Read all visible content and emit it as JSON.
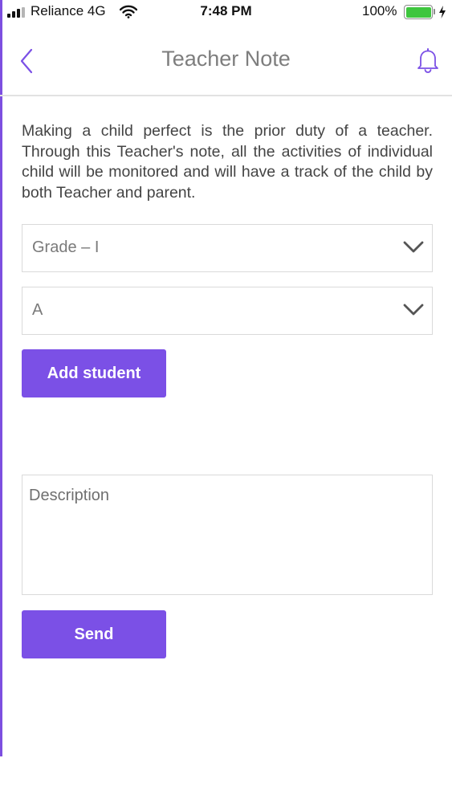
{
  "status_bar": {
    "carrier": "Reliance 4G",
    "time": "7:48 PM",
    "battery_percent": "100%",
    "battery_level": 1.0,
    "signal_bars_active": 3,
    "icons": [
      "signal-icon",
      "wifi-icon",
      "battery-icon",
      "charging-icon"
    ]
  },
  "header": {
    "title": "Teacher Note",
    "back_icon": "chevron-left-icon",
    "notification_icon": "bell-icon"
  },
  "intro_text": "Making a child perfect is the prior duty of a teacher. Through this Teacher's note, all the activities of individual child will be monitored and will have a track of the child by both Teacher and parent.",
  "form": {
    "grade_select": {
      "value": "Grade – I",
      "icon": "chevron-down-icon"
    },
    "section_select": {
      "value": "A",
      "icon": "chevron-down-icon"
    },
    "add_student_label": "Add student",
    "description_placeholder": "Description",
    "description_value": "",
    "send_label": "Send"
  },
  "colors": {
    "accent": "#7b50e6",
    "title": "#7e7e7e",
    "body_text": "#444444",
    "border": "#dadada"
  }
}
